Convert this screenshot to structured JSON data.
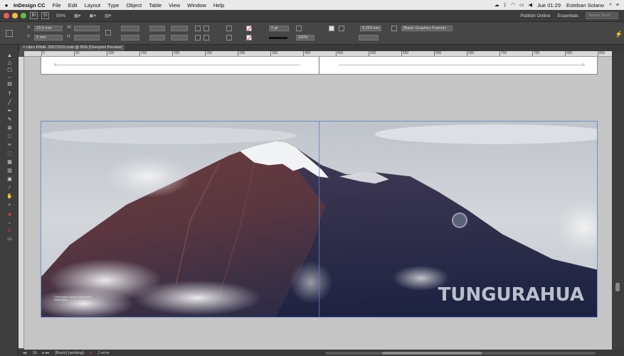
{
  "menubar": {
    "apple": "",
    "app_name": "InDesign CC",
    "items": [
      "File",
      "Edit",
      "Layout",
      "Type",
      "Object",
      "Table",
      "View",
      "Window",
      "Help"
    ],
    "clock": "Jue 01:29",
    "user": "Esteban Solano"
  },
  "appbar": {
    "zoom": "50%",
    "publish_online": "Publish Online",
    "workspace": "Essentials",
    "search_placeholder": "Adobe Stock"
  },
  "control_panel": {
    "x_value": "23,5 mm",
    "y_value": "0 mm",
    "stroke_weight": "0 pt",
    "opacity": "100%",
    "frame_value": "4,233 mm",
    "object_style": "[Basic Graphics Frame]+"
  },
  "document": {
    "tab_title": "Libro FINAL 30072015.indd @ 50% [Overprint Preview]",
    "ruler_ticks": [
      "0",
      "50",
      "100",
      "150",
      "200",
      "250",
      "300",
      "350",
      "400",
      "450",
      "500",
      "550",
      "600",
      "650",
      "700",
      "750",
      "800",
      "850"
    ]
  },
  "spread": {
    "headline": "TUNGURAHUA",
    "caption": "Lorem ipsum volcano caption text placeholder"
  },
  "statusbar": {
    "page": "16",
    "preflight": "[Basic] (working)",
    "errors": "1 error"
  },
  "colors": {
    "sky": "#c9ccd2",
    "mountain_dark": "#2a2f4a",
    "mountain_brown": "#7a4a42",
    "snow": "#f2f3f5",
    "frame_blue": "#6f8fc9"
  }
}
